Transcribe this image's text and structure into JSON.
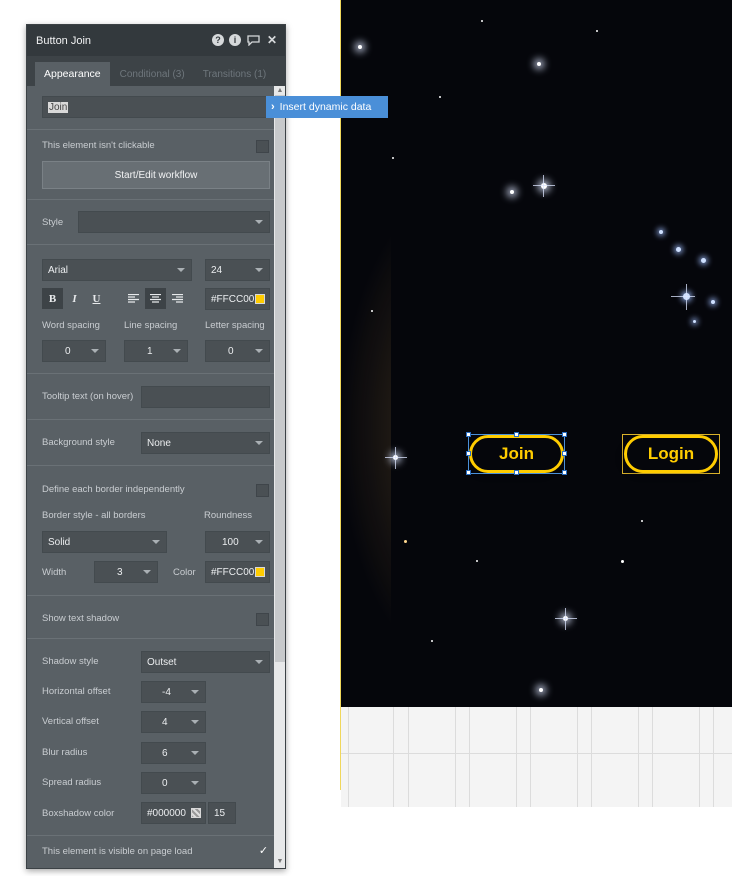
{
  "panel": {
    "title": "Button Join",
    "tabs": [
      {
        "label": "Appearance",
        "active": true
      },
      {
        "label": "Conditional (3)",
        "active": false
      },
      {
        "label": "Transitions (1)",
        "active": false
      }
    ],
    "text_value": "Join",
    "insert_dynamic_label": "Insert dynamic data",
    "not_clickable_label": "This element isn't clickable",
    "workflow_button": "Start/Edit workflow",
    "style_label": "Style",
    "style_value": "",
    "font_family": "Arial",
    "font_size": "24",
    "font_color": "#FFCC00",
    "word_spacing_label": "Word spacing",
    "line_spacing_label": "Line spacing",
    "letter_spacing_label": "Letter spacing",
    "word_spacing": "0",
    "line_spacing": "1",
    "letter_spacing": "0",
    "tooltip_label": "Tooltip text (on hover)",
    "tooltip_value": "",
    "background_label": "Background style",
    "background_value": "None",
    "border_each_label": "Define each border independently",
    "border_style_label": "Border style - all borders",
    "roundness_label": "Roundness",
    "border_style_value": "Solid",
    "roundness_value": "100",
    "width_label": "Width",
    "width_value": "3",
    "color_label": "Color",
    "border_color": "#FFCC00",
    "text_shadow_label": "Show text shadow",
    "shadow_style_label": "Shadow style",
    "shadow_style_value": "Outset",
    "h_offset_label": "Horizontal offset",
    "h_offset_value": "-4",
    "v_offset_label": "Vertical offset",
    "v_offset_value": "4",
    "blur_label": "Blur radius",
    "blur_value": "6",
    "spread_label": "Spread radius",
    "spread_value": "0",
    "boxshadow_color_label": "Boxshadow color",
    "boxshadow_color": "#000000",
    "boxshadow_opacity": "15",
    "visible_label": "This element is visible on page load",
    "visible_checked": true
  },
  "format_buttons": {
    "bold": "B",
    "italic": "I",
    "underline": "U"
  },
  "canvas": {
    "join_label": "Join",
    "login_label": "Login",
    "button_color": "#FFCC00",
    "selection_color": "#4a90d9"
  }
}
